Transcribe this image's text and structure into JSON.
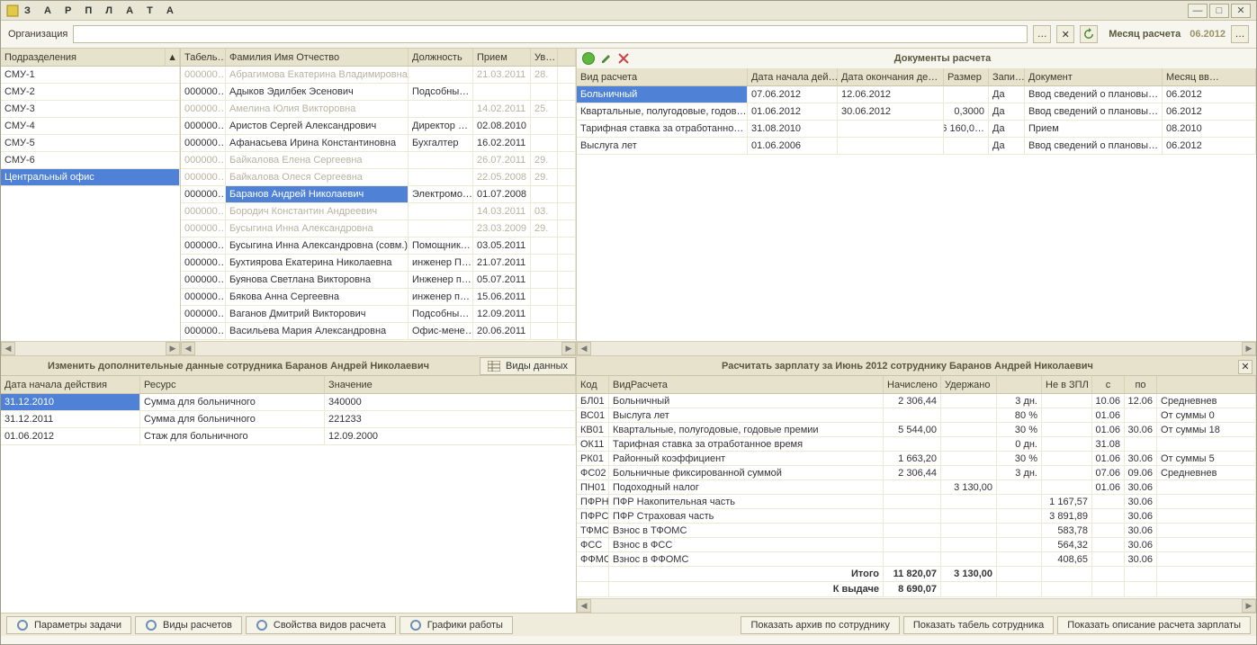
{
  "title": "З А Р П Л А Т А",
  "org_label": "Организация",
  "month_label": "Месяц расчета",
  "month_value": "06.2012",
  "dept": {
    "header": "Подразделения",
    "items": [
      "СМУ-1",
      "СМУ-2",
      "СМУ-3",
      "СМУ-4",
      "СМУ-5",
      "СМУ-6",
      "Центральный офис"
    ],
    "selected": 6
  },
  "emp": {
    "headers": {
      "tab": "Табель…",
      "fio": "Фамилия Имя Отчество",
      "pos": "Должность",
      "hire": "Прием",
      "uv": "Ув…"
    },
    "rows": [
      {
        "tab": "000000…",
        "fio": "Абрагимова Екатерина Владимировна",
        "pos": "",
        "hire": "21.03.2011",
        "uv": "28.",
        "gray": true
      },
      {
        "tab": "000000…",
        "fio": "Адыков Эдилбек Эсенович",
        "pos": "Подсобны…",
        "hire": "",
        "uv": "",
        "gray": false
      },
      {
        "tab": "000000…",
        "fio": "Амелина Юлия Викторовна",
        "pos": "",
        "hire": "14.02.2011",
        "uv": "25.",
        "gray": true
      },
      {
        "tab": "000000…",
        "fio": "Аристов Сергей Александрович",
        "pos": "Директор …",
        "hire": "02.08.2010",
        "uv": "",
        "gray": false
      },
      {
        "tab": "000000…",
        "fio": "Афанасьева Ирина Константиновна",
        "pos": "Бухгалтер",
        "hire": "16.02.2011",
        "uv": "",
        "gray": false
      },
      {
        "tab": "000000…",
        "fio": "Байкалова Елена Сергеевна",
        "pos": "",
        "hire": "26.07.2011",
        "uv": "29.",
        "gray": true
      },
      {
        "tab": "000000…",
        "fio": "Байкалова Олеся Сергеевна",
        "pos": "",
        "hire": "22.05.2008",
        "uv": "29.",
        "gray": true
      },
      {
        "tab": "000000…",
        "fio": "Баранов Андрей Николаевич",
        "pos": "Электромо…",
        "hire": "01.07.2008",
        "uv": "",
        "gray": false,
        "selected": true
      },
      {
        "tab": "000000…",
        "fio": "Бородич Константин Андреевич",
        "pos": "",
        "hire": "14.03.2011",
        "uv": "03.",
        "gray": true
      },
      {
        "tab": "000000…",
        "fio": "Бусыгина Инна Александровна",
        "pos": "",
        "hire": "23.03.2009",
        "uv": "29.",
        "gray": true
      },
      {
        "tab": "000000…",
        "fio": "Бусыгина Инна Александровна (совм.)",
        "pos": "Помощник…",
        "hire": "03.05.2011",
        "uv": "",
        "gray": false
      },
      {
        "tab": "000000…",
        "fio": "Бухтиярова Екатерина Николаевна",
        "pos": "инженер П…",
        "hire": "21.07.2011",
        "uv": "",
        "gray": false
      },
      {
        "tab": "000000…",
        "fio": "Буянова Светлана Викторовна",
        "pos": "Инженер п…",
        "hire": "05.07.2011",
        "uv": "",
        "gray": false
      },
      {
        "tab": "000000…",
        "fio": "Бякова Анна Сергеевна",
        "pos": "инженер п…",
        "hire": "15.06.2011",
        "uv": "",
        "gray": false
      },
      {
        "tab": "000000…",
        "fio": "Ваганов Дмитрий Викторович",
        "pos": "Подсобны…",
        "hire": "12.09.2011",
        "uv": "",
        "gray": false
      },
      {
        "tab": "000000…",
        "fio": "Васильева Мария Александровна",
        "pos": "Офис-мене…",
        "hire": "20.06.2011",
        "uv": "",
        "gray": false
      }
    ]
  },
  "doc": {
    "title": "Документы расчета",
    "h": {
      "type": "Вид расчета",
      "start": "Дата начала дей…",
      "end": "Дата окончания де…",
      "size": "Размер",
      "zapi": "Запи…",
      "doc": "Документ",
      "mon": "Месяц вв…"
    },
    "rows": [
      {
        "type": "Больничный",
        "start": "07.06.2012",
        "end": "12.06.2012",
        "size": "",
        "zapi": "Да",
        "doc": "Ввод сведений о плановы…",
        "mon": "06.2012",
        "selected": true
      },
      {
        "type": "Квартальные, полугодовые, годов…",
        "start": "01.06.2012",
        "end": "30.06.2012",
        "size": "0,3000",
        "zapi": "Да",
        "doc": "Ввод сведений о плановы…",
        "mon": "06.2012"
      },
      {
        "type": "Тарифная ставка за отработанно…",
        "start": "31.08.2010",
        "end": "",
        "size": "6 160,0…",
        "zapi": "Да",
        "doc": "Прием",
        "mon": "08.2010"
      },
      {
        "type": "Выслуга лет",
        "start": "01.06.2006",
        "end": "",
        "size": "",
        "zapi": "Да",
        "doc": "Ввод сведений о плановы…",
        "mon": "06.2012"
      }
    ]
  },
  "extra": {
    "title": "Изменить дополнительные данные сотрудника Баранов Андрей Николаевич",
    "tab": "Виды данных",
    "h": {
      "date": "Дата начала действия",
      "res": "Ресурс",
      "val": "Значение"
    },
    "rows": [
      {
        "date": "31.12.2010",
        "res": "Сумма для больничного",
        "val": "340000",
        "selected": true
      },
      {
        "date": "31.12.2011",
        "res": "Сумма для больничного",
        "val": "221233"
      },
      {
        "date": "01.06.2012",
        "res": "Стаж для больничного",
        "val": "12.09.2000"
      }
    ]
  },
  "calc": {
    "title": "Расчитать зарплату за Июнь 2012 сотруднику Баранов Андрей Николаевич",
    "h": {
      "code": "Код",
      "type": "ВидРасчета",
      "nach": "Начислено",
      "ud": "Удержано",
      "blank": "",
      "nzpl": "Не в ЗПЛ",
      "s": "с",
      "po": "по",
      "extra": ""
    },
    "rows": [
      {
        "code": "БЛ01",
        "type": "Больничный",
        "nach": "2 306,44",
        "ud": "",
        "b": "3 дн.",
        "nzpl": "",
        "s": "10.06",
        "po": "12.06",
        "ex": "Средневнев"
      },
      {
        "code": "ВС01",
        "type": "Выслуга лет",
        "nach": "",
        "ud": "",
        "b": "80 %",
        "nzpl": "",
        "s": "01.06",
        "po": "",
        "ex": "От суммы 0"
      },
      {
        "code": "КВ01",
        "type": "Квартальные, полугодовые, годовые премии",
        "nach": "5 544,00",
        "ud": "",
        "b": "30 %",
        "nzpl": "",
        "s": "01.06",
        "po": "30.06",
        "ex": "От суммы 18"
      },
      {
        "code": "ОК11",
        "type": "Тарифная ставка за отработанное время",
        "nach": "",
        "ud": "",
        "b": "0 дн.",
        "nzpl": "",
        "s": "31.08",
        "po": "",
        "ex": ""
      },
      {
        "code": "РК01",
        "type": "Районный коэффициент",
        "nach": "1 663,20",
        "ud": "",
        "b": "30 %",
        "nzpl": "",
        "s": "01.06",
        "po": "30.06",
        "ex": "От суммы 5"
      },
      {
        "code": "ФС02",
        "type": "Больничные фиксированной суммой",
        "nach": "2 306,44",
        "ud": "",
        "b": "3 дн.",
        "nzpl": "",
        "s": "07.06",
        "po": "09.06",
        "ex": "Средневнев"
      },
      {
        "code": "ПН01",
        "type": "Подоходный налог",
        "nach": "",
        "ud": "3 130,00",
        "b": "",
        "nzpl": "",
        "s": "01.06",
        "po": "30.06",
        "ex": ""
      },
      {
        "code": "ПФРН",
        "type": "ПФР Накопительная часть",
        "nach": "",
        "ud": "",
        "b": "",
        "nzpl": "1 167,57",
        "s": "",
        "po": "30.06",
        "ex": ""
      },
      {
        "code": "ПФРС",
        "type": "ПФР Страховая часть",
        "nach": "",
        "ud": "",
        "b": "",
        "nzpl": "3 891,89",
        "s": "",
        "po": "30.06",
        "ex": ""
      },
      {
        "code": "ТФМС",
        "type": "Взнос в ТФОМС",
        "nach": "",
        "ud": "",
        "b": "",
        "nzpl": "583,78",
        "s": "",
        "po": "30.06",
        "ex": ""
      },
      {
        "code": "ФСС",
        "type": "Взнос в ФСС",
        "nach": "",
        "ud": "",
        "b": "",
        "nzpl": "564,32",
        "s": "",
        "po": "30.06",
        "ex": ""
      },
      {
        "code": "ФФМС",
        "type": "Взнос в ФФОМС",
        "nach": "",
        "ud": "",
        "b": "",
        "nzpl": "408,65",
        "s": "",
        "po": "30.06",
        "ex": ""
      }
    ],
    "totals": {
      "label": "Итого",
      "nach": "11 820,07",
      "ud": "3 130,00",
      "out_label": "К выдаче",
      "out": "8 690,07"
    }
  },
  "footer": {
    "left": [
      "Параметры задачи",
      "Виды расчетов",
      "Свойства видов расчета",
      "Графики работы"
    ],
    "right": [
      "Показать архив по сотруднику",
      "Показать табель сотрудника",
      "Показать описание расчета зарплаты"
    ]
  },
  "dots": "…"
}
